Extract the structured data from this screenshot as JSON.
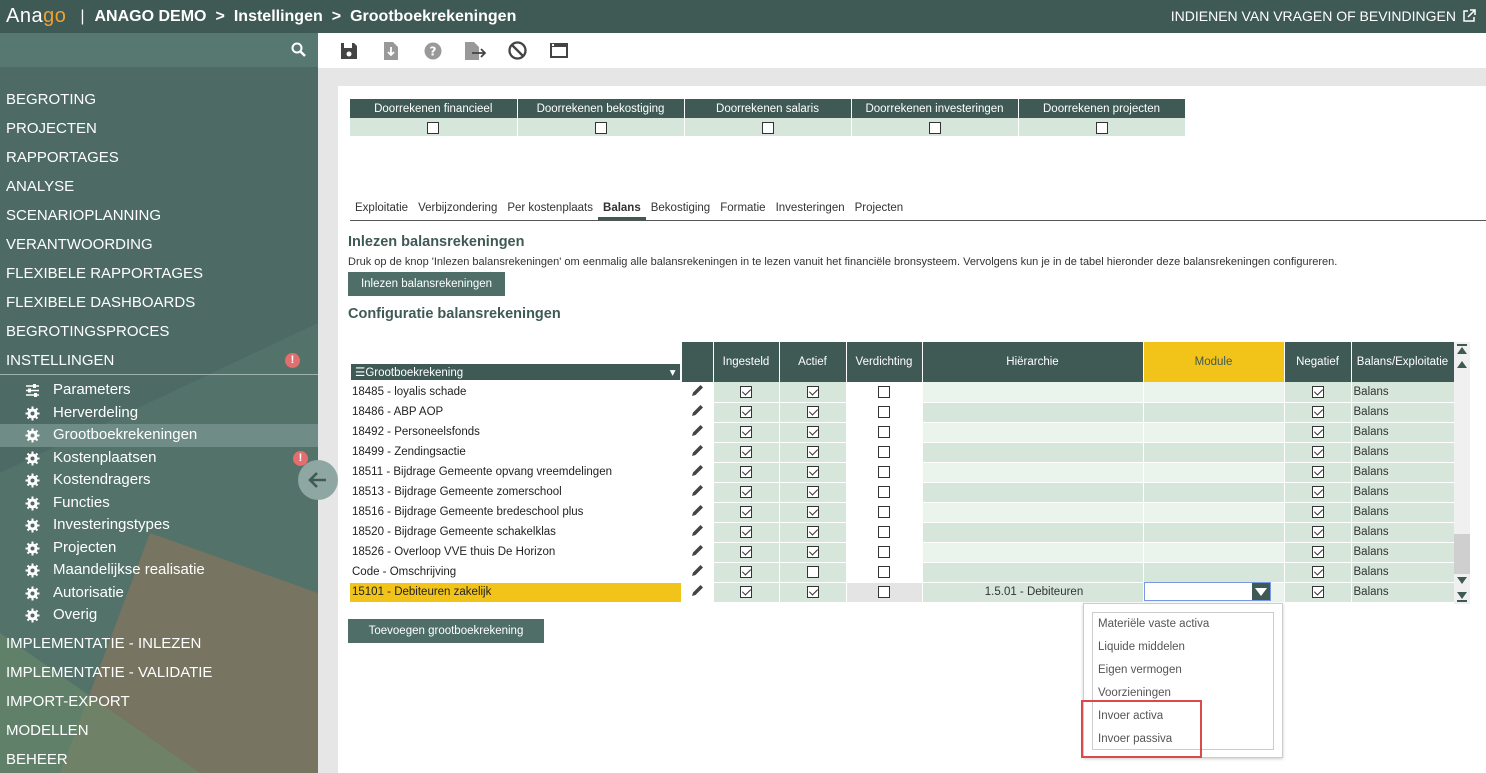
{
  "header": {
    "logo_a": "Ana",
    "logo_b": "go",
    "separator": "|",
    "crumbs": [
      "ANAGO DEMO",
      "Instellingen",
      "Grootboekrekeningen"
    ],
    "crumb_arrow": ">",
    "report_link": "INDIENEN VAN VRAGEN OF BEVINDINGEN"
  },
  "sidebar": {
    "menu_top": [
      "BEGROTING",
      "PROJECTEN",
      "RAPPORTAGES",
      "ANALYSE",
      "SCENARIOPLANNING",
      "VERANTWOORDING",
      "FLEXIBELE RAPPORTAGES",
      "FLEXIBELE DASHBOARDS",
      "BEGROTINGSPROCES"
    ],
    "menu_open": "INSTELLINGEN",
    "alert": "!",
    "submenu": [
      "Parameters",
      "Herverdeling",
      "Grootboekrekeningen",
      "Kostenplaatsen",
      "Kostendragers",
      "Functies",
      "Investeringstypes",
      "Projecten",
      "Maandelijkse realisatie",
      "Autorisatie",
      "Overig"
    ],
    "menu_bottom": [
      "IMPLEMENTATIE - INLEZEN",
      "IMPLEMENTATIE - VALIDATIE",
      "IMPORT-EXPORT",
      "MODELLEN",
      "BEHEER"
    ]
  },
  "calc_headers": [
    "Doorrekenen financieel",
    "Doorrekenen bekostiging",
    "Doorrekenen salaris",
    "Doorrekenen investeringen",
    "Doorrekenen projecten"
  ],
  "tabs": [
    "Exploitatie",
    "Verbijzondering",
    "Per kostenplaats",
    "Balans",
    "Bekostiging",
    "Formatie",
    "Investeringen",
    "Projecten"
  ],
  "inlezen": {
    "title": "Inlezen balansrekeningen",
    "desc": "Druk op de knop 'Inlezen balansrekeningen' om eenmalig alle balansrekeningen in te lezen vanuit het financiële bronsysteem. Vervolgens kun je in de tabel hieronder deze balansrekeningen configureren.",
    "button": "Inlezen balansrekeningen"
  },
  "config": {
    "title": "Configuratie balansrekeningen",
    "col_gk": "Grootboekrekening",
    "headers": [
      "Ingesteld",
      "Actief",
      "Verdichting",
      "Hiërarchie",
      "Module",
      "Negatief",
      "Balans/Exploitatie"
    ],
    "rows": [
      {
        "code": "18485 - loyalis schade",
        "hier": "",
        "be": "Balans"
      },
      {
        "code": "18486 - ABP AOP",
        "hier": "",
        "be": "Balans"
      },
      {
        "code": "18492 - Personeelsfonds",
        "hier": "",
        "be": "Balans"
      },
      {
        "code": "18499 - Zendingsactie",
        "hier": "",
        "be": "Balans"
      },
      {
        "code": "18511 - Bijdrage Gemeente opvang vreemdelingen",
        "hier": "",
        "be": "Balans"
      },
      {
        "code": "18513 - Bijdrage Gemeente zomerschool",
        "hier": "",
        "be": "Balans"
      },
      {
        "code": "18516 - Bijdrage Gemeente bredeschool plus",
        "hier": "",
        "be": "Balans"
      },
      {
        "code": "18520 - Bijdrage Gemeente schakelklas",
        "hier": "",
        "be": "Balans"
      },
      {
        "code": "18526 - Overloop VVE thuis De Horizon",
        "hier": "",
        "be": "Balans"
      },
      {
        "code": "Code - Omschrijving",
        "hier": "",
        "be": "Balans"
      },
      {
        "code": "15101 - Debiteuren zakelijk",
        "hier": "1.5.01 - Debiteuren",
        "be": "Balans"
      }
    ],
    "add_button": "Toevoegen grootboekrekening"
  },
  "dropdown_options": [
    "Materiële vaste activa",
    "Liquide middelen",
    "Eigen vermogen",
    "Voorzieningen",
    "Invoer activa",
    "Invoer passiva"
  ]
}
